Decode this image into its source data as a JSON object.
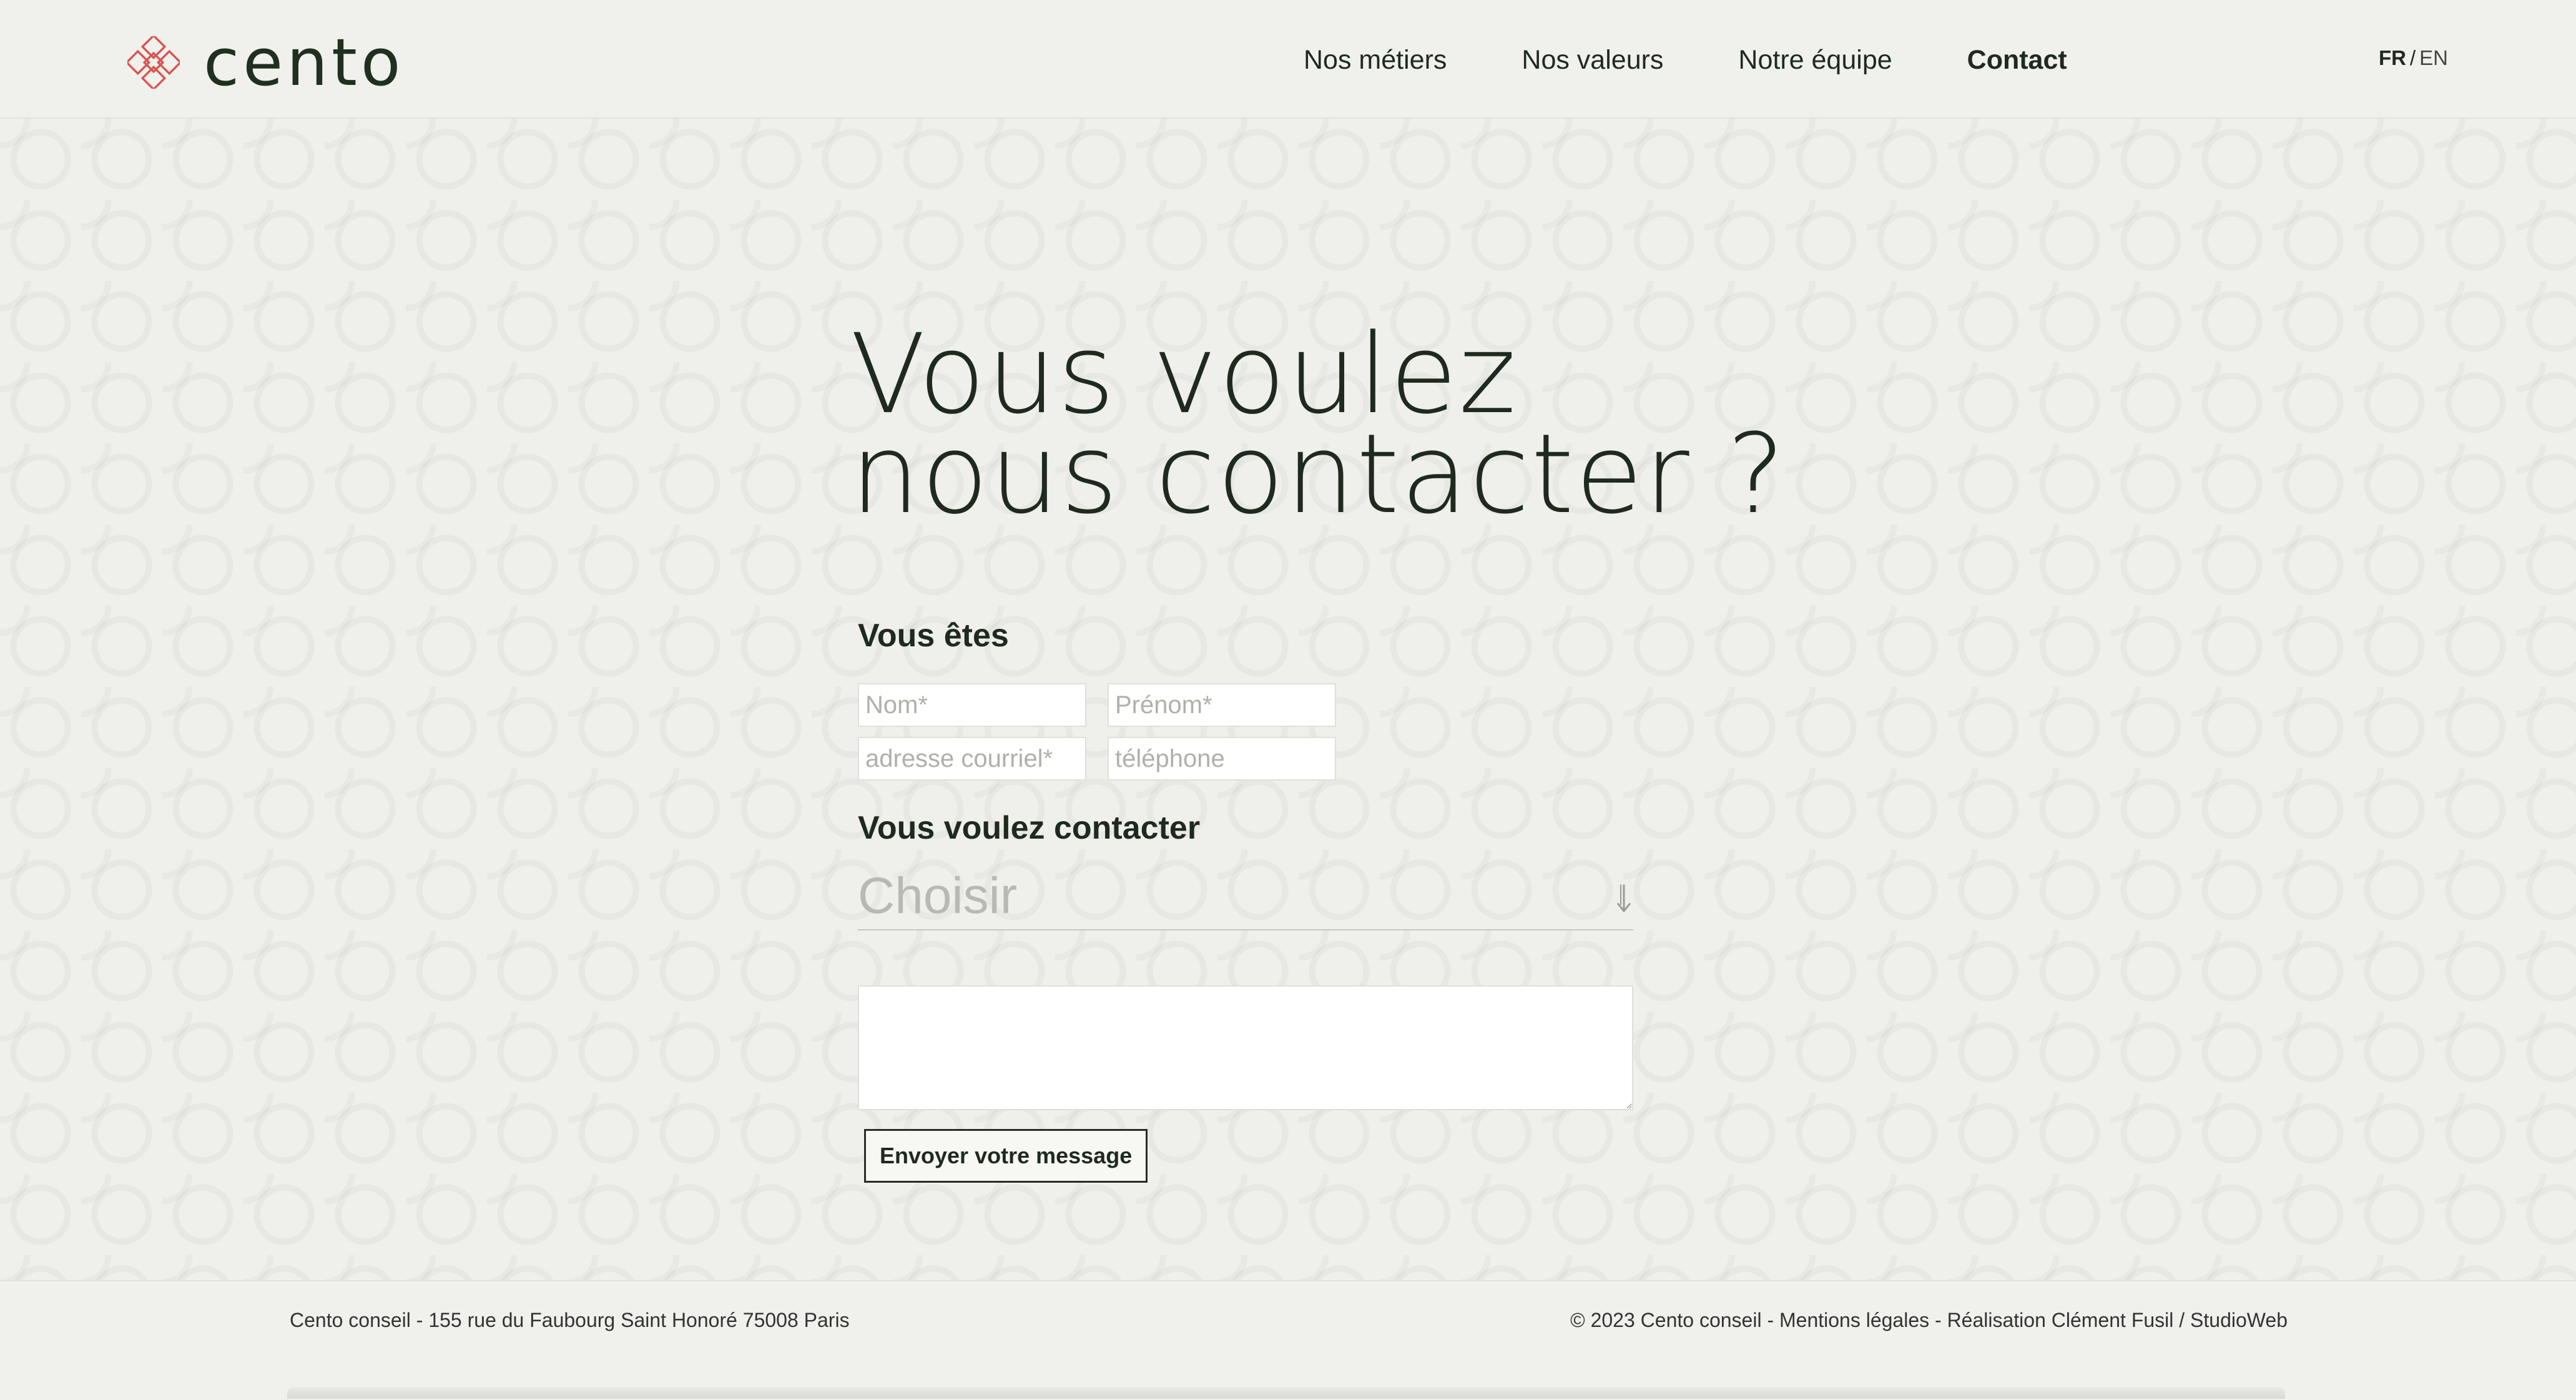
{
  "brand": {
    "name": "cento",
    "accent_color": "#d9534f",
    "logo_icon": "cross-pattern-logo-icon"
  },
  "nav": {
    "items": [
      {
        "label": "Nos métiers",
        "active": false
      },
      {
        "label": "Nos valeurs",
        "active": false
      },
      {
        "label": "Notre équipe",
        "active": false
      },
      {
        "label": "Contact",
        "active": true
      }
    ]
  },
  "language": {
    "current": "FR",
    "separator": "/",
    "alternate": "EN"
  },
  "hero": {
    "line1": "Vous voulez",
    "line2": "nous contacter ?"
  },
  "form": {
    "section_you": "Vous êtes",
    "fields": {
      "nom": {
        "placeholder": "Nom*",
        "value": ""
      },
      "prenom": {
        "placeholder": "Prénom*",
        "value": ""
      },
      "email": {
        "placeholder": "adresse courriel*",
        "value": ""
      },
      "phone": {
        "placeholder": "téléphone",
        "value": ""
      }
    },
    "section_contact": "Vous voulez contacter",
    "select": {
      "selected": "Choisir",
      "icon": "arrow-down-icon"
    },
    "message": {
      "value": ""
    },
    "submit_label": "Envoyer votre message"
  },
  "footer": {
    "address": "Cento conseil - 155 rue du Faubourg Saint Honoré 75008 Paris",
    "legal": "© 2023 Cento conseil - Mentions légales - Réalisation Clément Fusil / StudioWeb"
  }
}
